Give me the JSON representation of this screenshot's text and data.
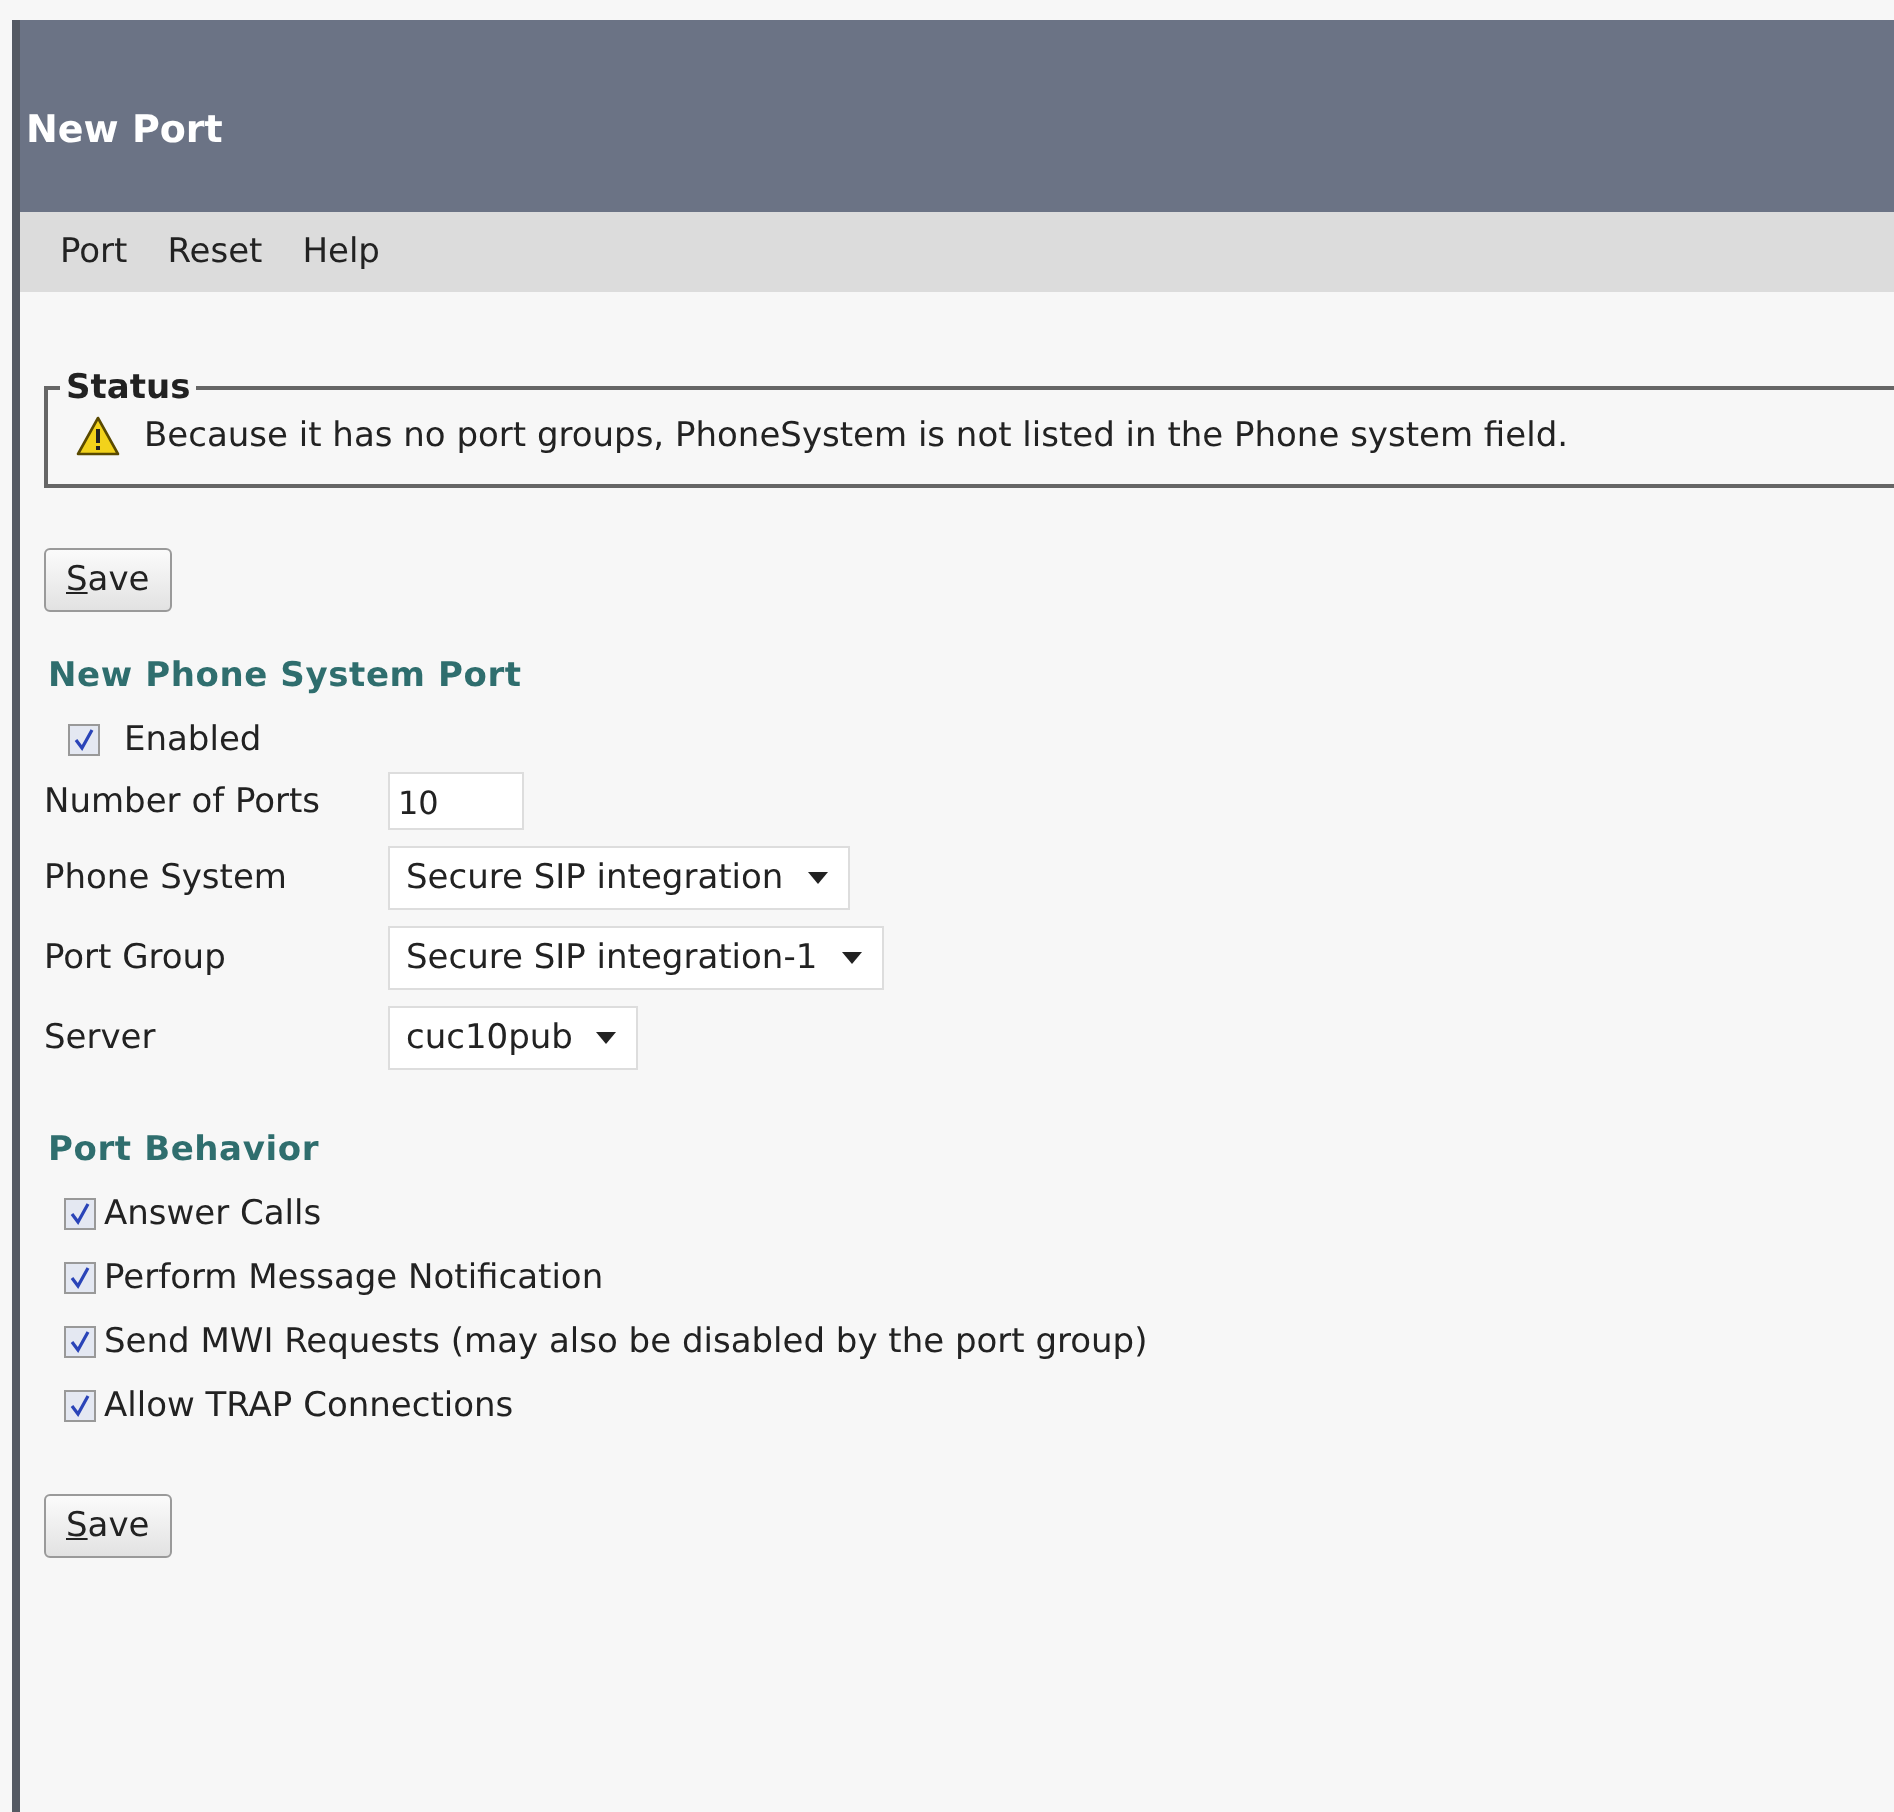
{
  "window": {
    "title": "New Port"
  },
  "menu": [
    "Port",
    "Reset",
    "Help"
  ],
  "status": {
    "legend": "Status",
    "message": "Because it has no port groups, PhoneSystem is not listed in the Phone system field."
  },
  "save_top": {
    "label": "Save"
  },
  "new_port": {
    "heading": "New Phone System Port",
    "enabled": {
      "label": "Enabled",
      "checked": true
    },
    "fields": [
      {
        "kind": "text",
        "label": "Number of Ports",
        "value": "10"
      },
      {
        "kind": "select",
        "label": "Phone System",
        "value": "Secure SIP integration"
      },
      {
        "kind": "select",
        "label": "Port Group",
        "value": "Secure SIP integration-1"
      },
      {
        "kind": "select",
        "label": "Server",
        "value": "cuc10pub"
      }
    ]
  },
  "behavior": {
    "heading": "Port Behavior",
    "options": [
      {
        "label": "Answer Calls",
        "checked": true
      },
      {
        "label": "Perform Message Notification",
        "checked": true
      },
      {
        "label": "Send MWI Requests (may also be disabled by the port group)",
        "checked": true
      },
      {
        "label": "Allow TRAP Connections",
        "checked": true
      }
    ]
  },
  "save_bottom": {
    "label": "Save"
  }
}
